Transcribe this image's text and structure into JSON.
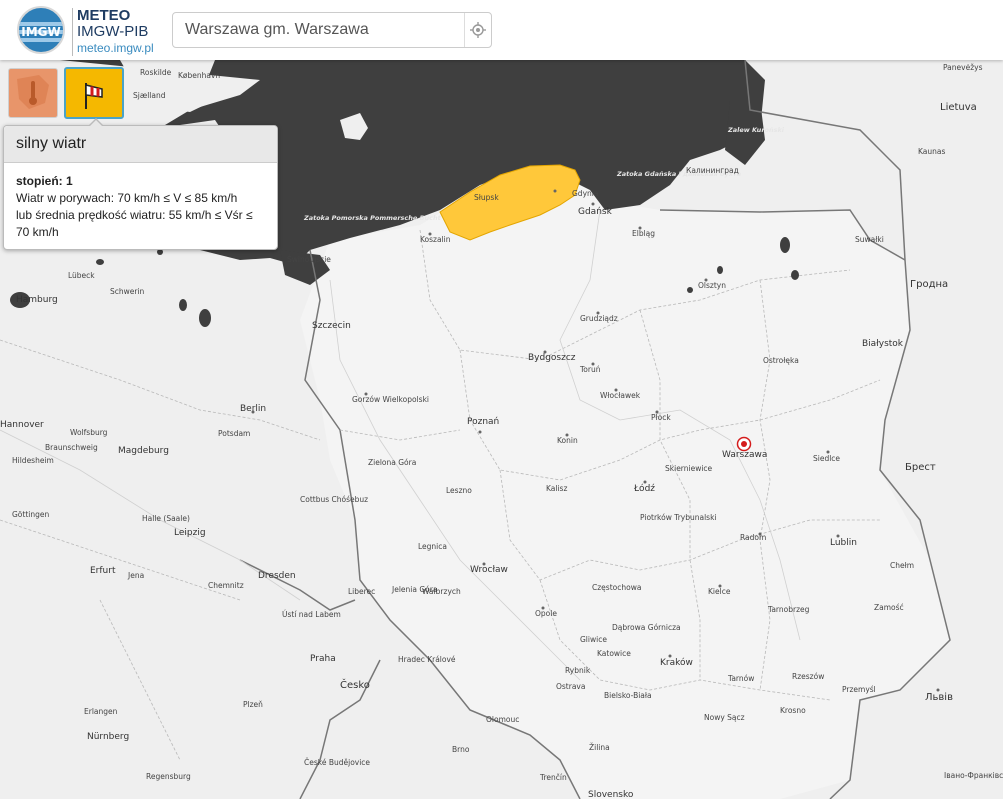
{
  "header": {
    "logo_badge": "IMGW",
    "logo_title": "METEO",
    "logo_subtitle": "IMGW-PIB",
    "logo_url": "meteo.imgw.pl",
    "search_value": "Warszawa gm. Warszawa",
    "location_icon": "crosshair-icon"
  },
  "warning_buttons": [
    {
      "icon": "thermometer-map-icon",
      "color": "#e8956a",
      "active": false
    },
    {
      "icon": "windsock-icon",
      "color": "#f5b800",
      "active": true
    }
  ],
  "popup": {
    "title": "silny wiatr",
    "level": "stopień: 1",
    "line1": "Wiatr w porywach: 70 km/h ≤ V ≤ 85 km/h",
    "line2": "lub średnia prędkość wiatru: 55 km/h ≤ Vśr ≤",
    "line3": "70 km/h"
  },
  "colors": {
    "sea": "#3f3f3f",
    "land": "#efefef",
    "warning_zone": "#ffc83a",
    "marker": "#d41c1c"
  },
  "map": {
    "selected_location": "Warszawa",
    "countries": [
      "Lietuva",
      "Гродна",
      "Брест",
      "Львів",
      "Česko"
    ],
    "sea_labels": [
      "Zatoka Pomorska Pommersche Bucht",
      "Zatoka Gdańska Гданьская бухта",
      "Zalew Kuroński"
    ],
    "cities": [
      "København",
      "Roskilde",
      "Sjælland",
      "Panevėžys",
      "Kaunas",
      "Калининград",
      "Słupsk",
      "Gdynia",
      "Gdańsk",
      "Elbląg",
      "Koszalin",
      "Lübeck",
      "Schwerin",
      "Świnoujście",
      "Hamburg",
      "Szczecin",
      "Olsztyn",
      "Suwałki",
      "Grudziądz",
      "Białystok",
      "Bydgoszcz",
      "Toruń",
      "Ostrołęka",
      "Gorzów Wielkopolski",
      "Włocławek",
      "Płock",
      "Berlin",
      "Poznań",
      "Konin",
      "Hannover",
      "Wolfsburg",
      "Potsdam",
      "Braunschweig",
      "Magdeburg",
      "Hildesheim",
      "Warszawa",
      "Siedlce",
      "Skierniewice",
      "Zielona Góra",
      "Leszno",
      "Kalisz",
      "Łódź",
      "Cottbus Chóśebuz",
      "Göttingen",
      "Halle (Saale)",
      "Leipzig",
      "Piotrków Trybunalski",
      "Radom",
      "Lublin",
      "Legnica",
      "Chełm",
      "Wrocław",
      "Erfurt",
      "Jena",
      "Chemnitz",
      "Dresden",
      "Liberec",
      "Jelenia Góra",
      "Wałbrzych",
      "Częstochowa",
      "Kielce",
      "Opole",
      "Tarnobrzeg",
      "Zamość",
      "Ústí nad Labem",
      "Gliwice",
      "Dąbrowa Górnicza",
      "Katowice",
      "Kraków",
      "Praha",
      "Hradec Králové",
      "Rybnik",
      "Tarnów",
      "Rzeszów",
      "Przemyśl",
      "Ostrava",
      "Bielsko-Biała",
      "Plzeň",
      "Nowy Sącz",
      "Krosno",
      "Erlangen",
      "Olomouc",
      "Nürnberg",
      "Brno",
      "Žilina",
      "České Budějovice",
      "Regensburg",
      "Trenčín",
      "Slovensko",
      "Івано-Франківськ"
    ]
  }
}
